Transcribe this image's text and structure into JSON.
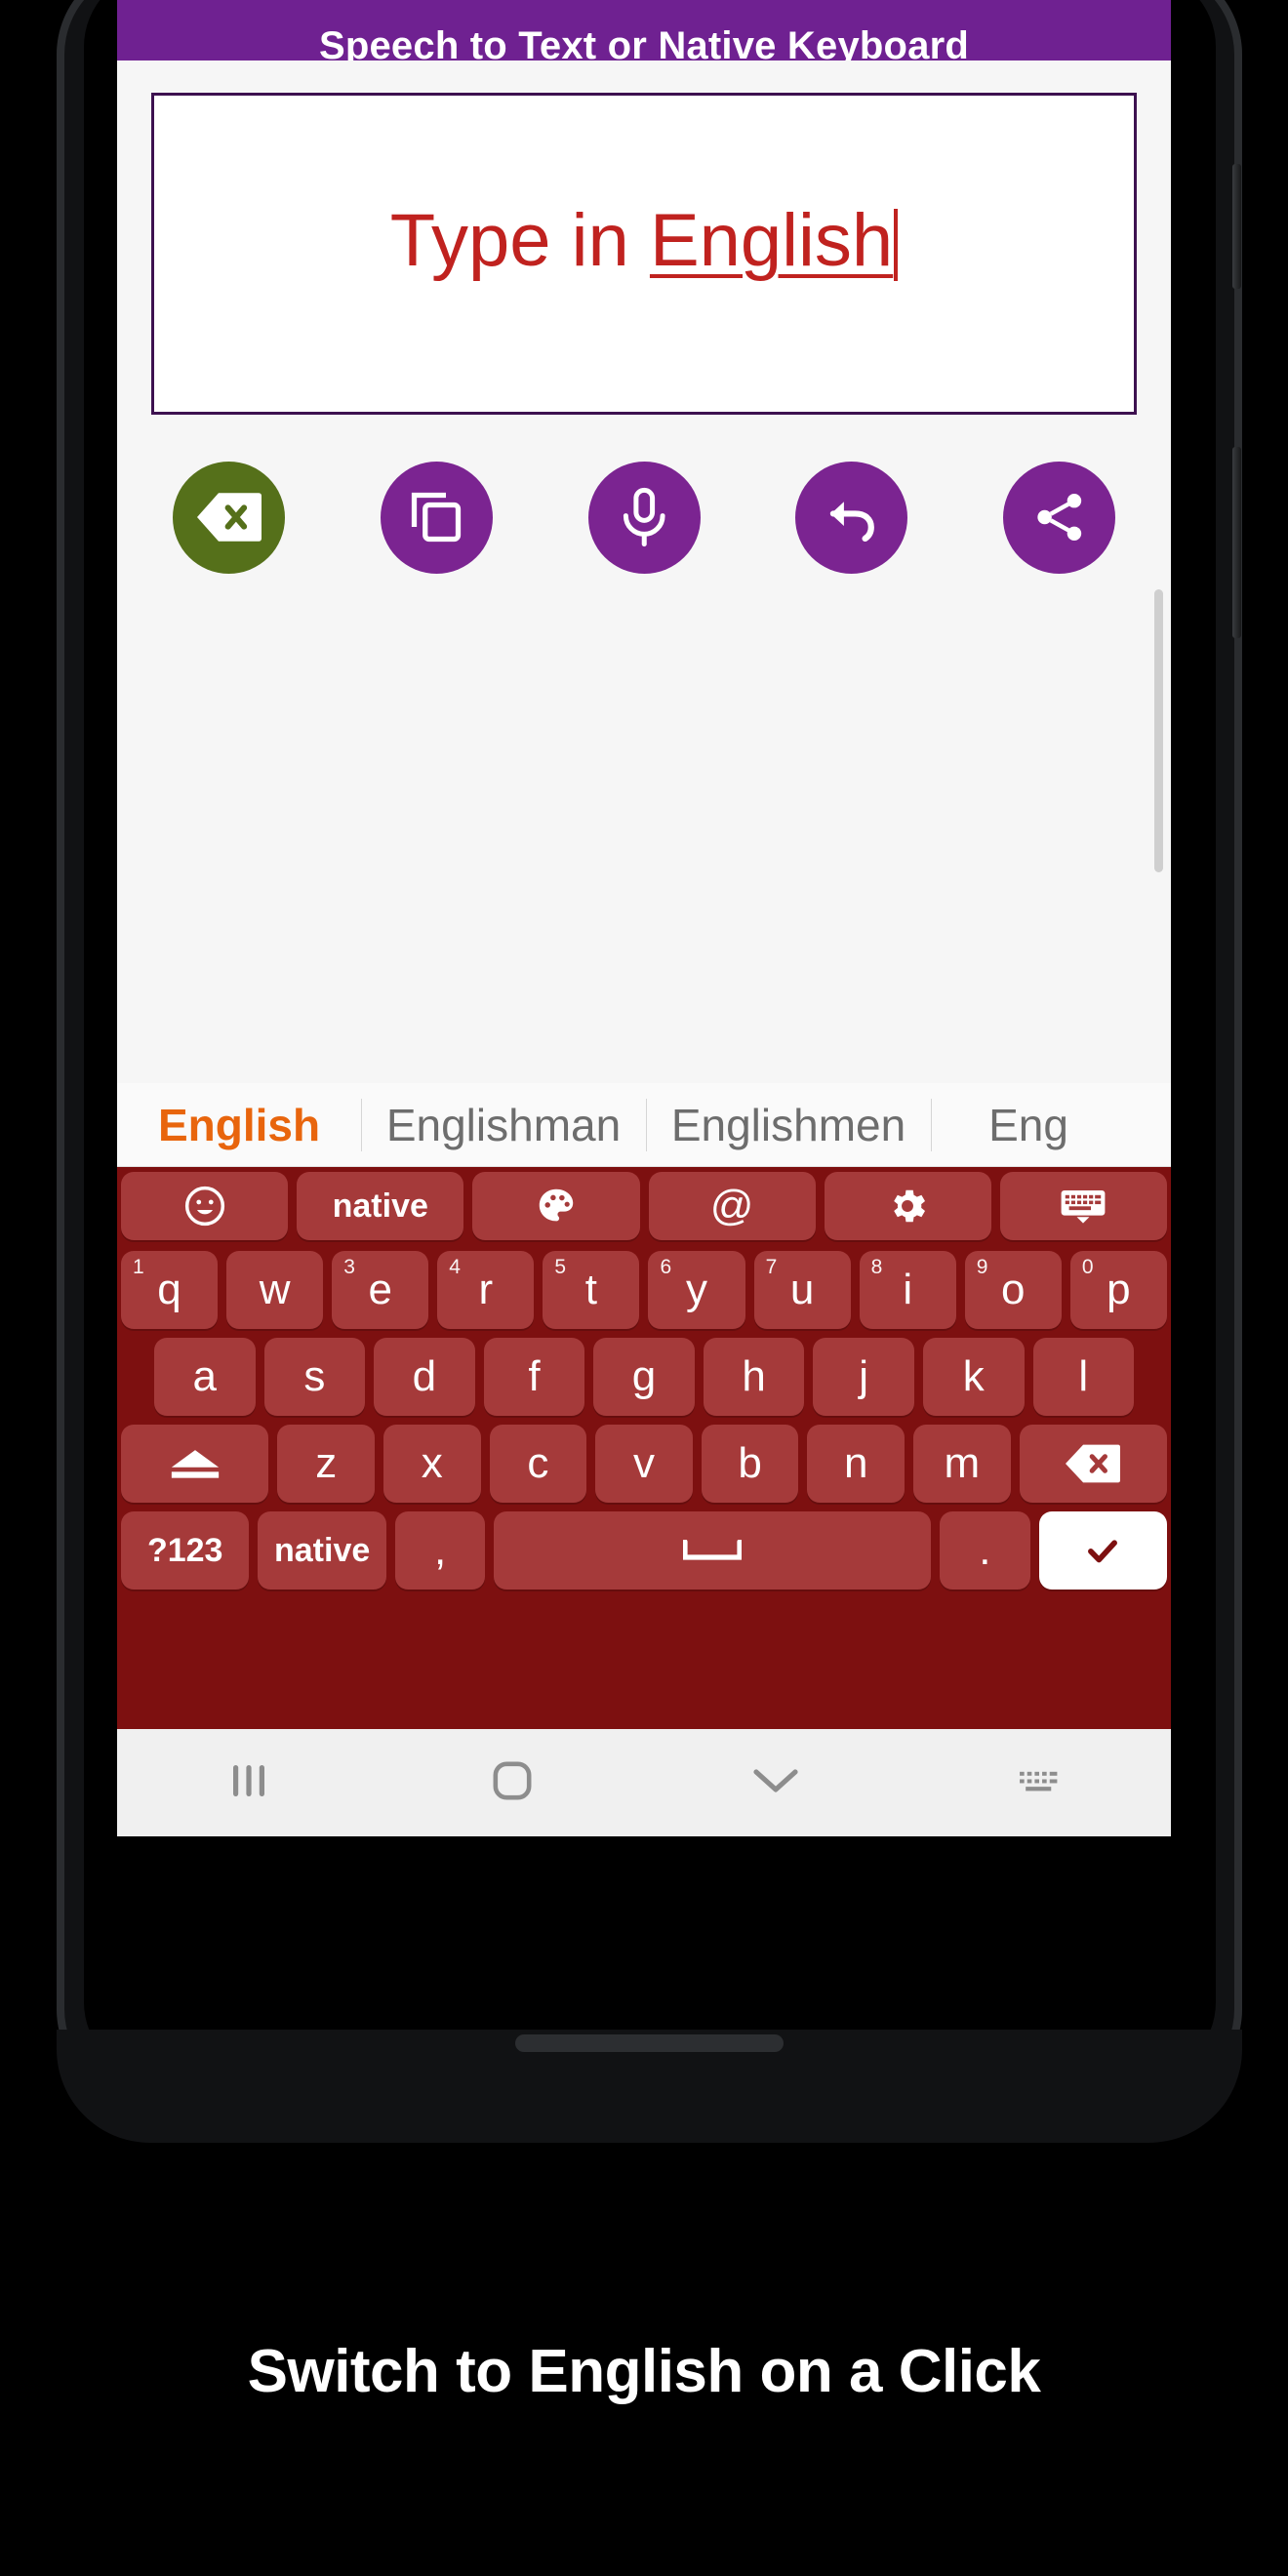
{
  "app": {
    "title": "Speech to Text or Native Keyboard",
    "accent_purple": "#6f2191",
    "keyboard_bg": "#7d1010",
    "key_bg": "#a53a3a",
    "suggestion_active_color": "#e8650d",
    "input_text_color": "#c0221f"
  },
  "input": {
    "text_prefix": "Type in ",
    "text_underlined": "English",
    "full_text": "Type in English"
  },
  "actions": [
    {
      "name": "backspace-button",
      "icon": "backspace-icon",
      "bg": "#55701a",
      "label": "Backspace"
    },
    {
      "name": "copy-button",
      "icon": "copy-icon",
      "bg": "#7b2491",
      "label": "Copy"
    },
    {
      "name": "microphone-button",
      "icon": "microphone-icon",
      "bg": "#7b2491",
      "label": "Speak"
    },
    {
      "name": "undo-button",
      "icon": "undo-icon",
      "bg": "#7b2491",
      "label": "Undo"
    },
    {
      "name": "share-button",
      "icon": "share-icon",
      "bg": "#7b2491",
      "label": "Share"
    }
  ],
  "suggestions": [
    {
      "label": "English",
      "active": true
    },
    {
      "label": "Englishman",
      "active": false
    },
    {
      "label": "Englishmen",
      "active": false
    },
    {
      "label": "Eng",
      "active": false
    }
  ],
  "keyboard": {
    "function_row": [
      {
        "label": "",
        "icon": "emoji-icon",
        "name": "key-emoji"
      },
      {
        "label": "native",
        "icon": "",
        "name": "key-native-language"
      },
      {
        "label": "",
        "icon": "palette-icon",
        "name": "key-theme-palette"
      },
      {
        "label": "@",
        "icon": "",
        "name": "key-at-sign"
      },
      {
        "label": "",
        "icon": "gear-icon",
        "name": "key-settings"
      },
      {
        "label": "",
        "icon": "keyboard-icon",
        "name": "key-keyboard-switch"
      }
    ],
    "row1": [
      {
        "key": "q",
        "num": "1"
      },
      {
        "key": "w",
        "num": ""
      },
      {
        "key": "e",
        "num": "3"
      },
      {
        "key": "r",
        "num": "4"
      },
      {
        "key": "t",
        "num": "5"
      },
      {
        "key": "y",
        "num": "6"
      },
      {
        "key": "u",
        "num": "7"
      },
      {
        "key": "i",
        "num": "8"
      },
      {
        "key": "o",
        "num": "9"
      },
      {
        "key": "p",
        "num": "0"
      }
    ],
    "row2": [
      "a",
      "s",
      "d",
      "f",
      "g",
      "h",
      "j",
      "k",
      "l"
    ],
    "row3": {
      "shift": "shift-icon",
      "keys": [
        "z",
        "x",
        "c",
        "v",
        "b",
        "n",
        "m"
      ],
      "backspace": "backspace-icon"
    },
    "row4": {
      "symbols": "?123",
      "language": "native",
      "comma": ",",
      "space": "space-icon",
      "period": ".",
      "enter": "check-icon"
    }
  },
  "navbar": [
    {
      "name": "nav-recents",
      "icon": "recents-icon"
    },
    {
      "name": "nav-home",
      "icon": "home-icon"
    },
    {
      "name": "nav-back-down",
      "icon": "chevron-down-icon"
    },
    {
      "name": "nav-keyboard",
      "icon": "keyboard-dots-icon"
    }
  ],
  "caption": "Switch to English on a Click"
}
